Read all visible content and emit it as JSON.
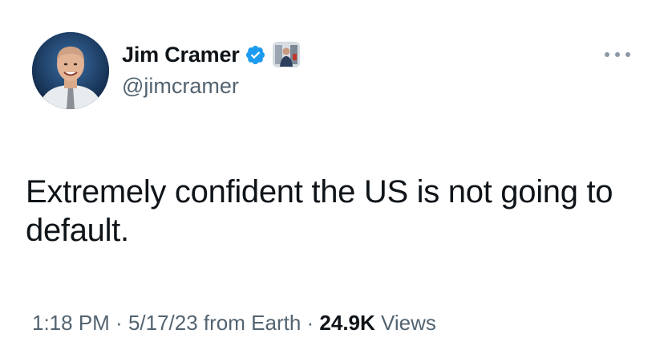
{
  "author": {
    "display_name": "Jim Cramer",
    "handle": "@jimcramer",
    "verified": true,
    "verified_color": "#1d9bf0",
    "avatar_icon": "profile-photo",
    "affiliate_icon": "affiliate-badge"
  },
  "tweet": {
    "text": "Extremely confident the US is not going to default."
  },
  "meta": {
    "time": "1:18 PM",
    "separator": " · ",
    "date": "5/17/23",
    "source": "from Earth",
    "views_count": "24.9K",
    "views_label": "Views"
  },
  "actions": {
    "more_icon": "more-icon"
  },
  "colors": {
    "text_primary": "#0f1419",
    "text_secondary": "#536471",
    "background": "#ffffff"
  }
}
